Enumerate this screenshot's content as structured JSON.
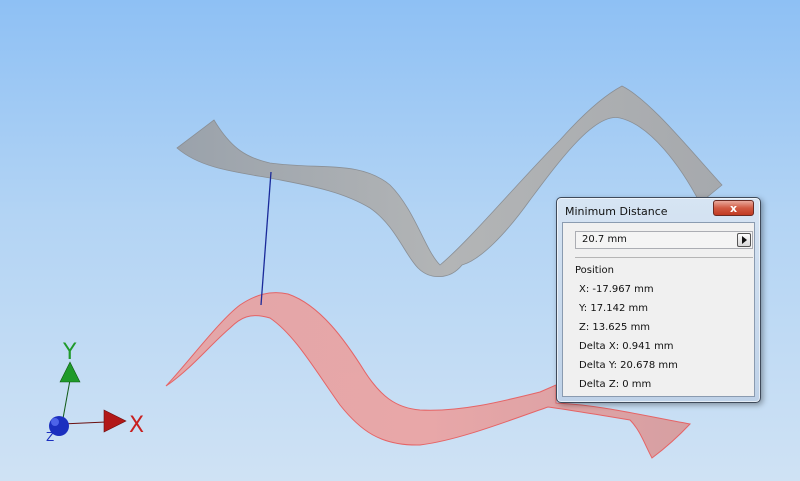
{
  "axes": {
    "x_label": "X",
    "y_label": "Y",
    "z_label": "Z",
    "x_color": "#c82020",
    "y_color": "#1f9a2a",
    "z_color": "#1b2fbf"
  },
  "colors": {
    "background_top": "#8ec0f4",
    "background_bottom": "#cfe2f4",
    "upper_surface": "#a7adb4",
    "lower_surface": "#e9a0a0",
    "distance_line": "#1a2a9a"
  },
  "dialog": {
    "title": "Minimum Distance",
    "close_icon": "close-icon",
    "distance_value": "20.7 mm",
    "position_header": "Position",
    "rows": [
      "X: -17.967 mm",
      "Y: 17.142 mm",
      "Z: 13.625 mm",
      "Delta X: 0.941 mm",
      "Delta Y: 20.678 mm",
      "Delta Z: 0 mm"
    ]
  }
}
